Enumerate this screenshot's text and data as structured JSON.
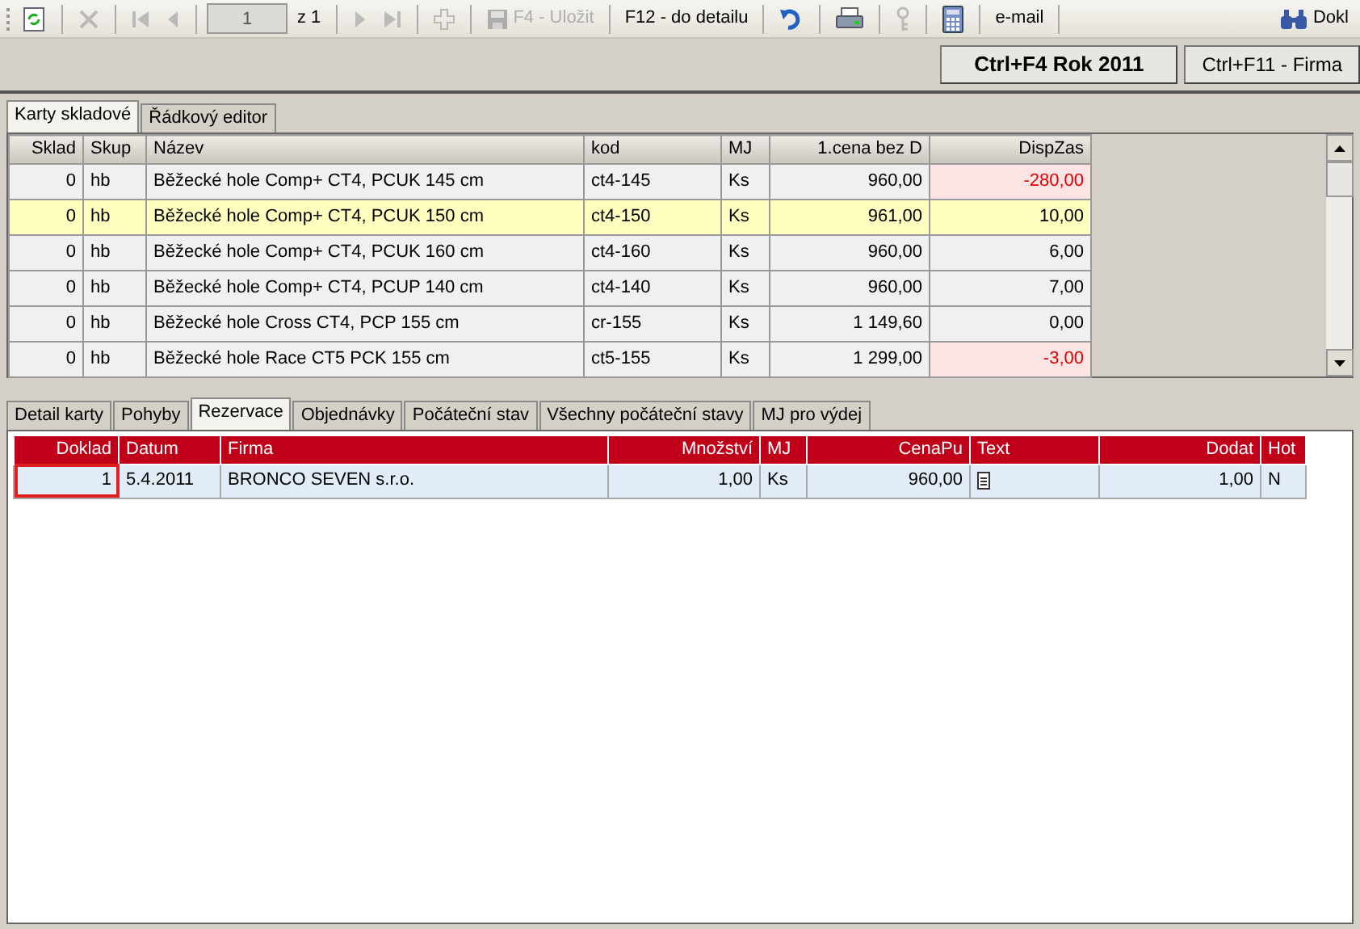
{
  "toolbar": [
    {
      "kind": "refresh",
      "disabled": false
    },
    {
      "kind": "sep"
    },
    {
      "kind": "delete",
      "disabled": true
    },
    {
      "kind": "sep"
    },
    {
      "kind": "first",
      "disabled": true
    },
    {
      "kind": "prev",
      "disabled": true
    },
    {
      "kind": "sep"
    },
    {
      "kind": "page",
      "value": "1",
      "label": "z 1"
    },
    {
      "kind": "sep"
    },
    {
      "kind": "next",
      "disabled": true
    },
    {
      "kind": "last",
      "disabled": true
    },
    {
      "kind": "sep"
    },
    {
      "kind": "add",
      "disabled": true
    },
    {
      "kind": "sep"
    },
    {
      "kind": "save",
      "label": "F4 - Uložit",
      "disabled": true
    },
    {
      "kind": "sep"
    },
    {
      "kind": "text",
      "label": "F12 - do detailu",
      "disabled": false
    },
    {
      "kind": "sep"
    },
    {
      "kind": "undo",
      "disabled": false
    },
    {
      "kind": "sep"
    },
    {
      "kind": "print",
      "disabled": false
    },
    {
      "kind": "sep"
    },
    {
      "kind": "key",
      "disabled": true
    },
    {
      "kind": "sep"
    },
    {
      "kind": "calc",
      "disabled": false
    },
    {
      "kind": "sep"
    },
    {
      "kind": "text",
      "label": "e-mail",
      "disabled": false
    },
    {
      "kind": "sep"
    },
    {
      "kind": "spacer"
    },
    {
      "kind": "find",
      "label": "Dokl",
      "disabled": false
    }
  ],
  "actions": [
    {
      "label": "Ctrl+F4 Rok 2011",
      "bold": true
    },
    {
      "label": "Ctrl+F11 - Firma",
      "bold": false
    }
  ],
  "upper_tabs": [
    {
      "label": "Karty skladové",
      "selected": true
    },
    {
      "label": "Řádkový editor",
      "selected": false
    }
  ],
  "stock_table": {
    "columns": [
      "Sklad",
      "Skup",
      "Název",
      "kod",
      "MJ",
      "1.cena bez D",
      "DispZas"
    ],
    "rows": [
      {
        "selected": false,
        "alert": true,
        "cells": [
          "0",
          "hb",
          "Běžecké hole Comp+ CT4, PCUK 145 cm",
          "ct4-145",
          "Ks",
          "960,00",
          "-280,00"
        ]
      },
      {
        "selected": true,
        "alert": false,
        "cells": [
          "0",
          "hb",
          "Běžecké hole Comp+ CT4, PCUK 150 cm",
          "ct4-150",
          "Ks",
          "961,00",
          "10,00"
        ]
      },
      {
        "selected": false,
        "alert": false,
        "cells": [
          "0",
          "hb",
          "Běžecké hole Comp+ CT4, PCUK 160 cm",
          "ct4-160",
          "Ks",
          "960,00",
          "6,00"
        ]
      },
      {
        "selected": false,
        "alert": false,
        "cells": [
          "0",
          "hb",
          "Běžecké hole Comp+ CT4, PCUP 140 cm",
          "ct4-140",
          "Ks",
          "960,00",
          "7,00"
        ]
      },
      {
        "selected": false,
        "alert": false,
        "cells": [
          "0",
          "hb",
          "Běžecké hole Cross CT4, PCP 155 cm",
          "cr-155",
          "Ks",
          "1 149,60",
          "0,00"
        ]
      },
      {
        "selected": false,
        "alert": true,
        "cells": [
          "0",
          "hb",
          "Běžecké hole Race CT5 PCK 155 cm",
          "ct5-155",
          "Ks",
          "1 299,00",
          "-3,00"
        ]
      }
    ]
  },
  "lower_tabs": [
    {
      "label": "Detail karty",
      "selected": false
    },
    {
      "label": "Pohyby",
      "selected": false
    },
    {
      "label": "Rezervace",
      "selected": true
    },
    {
      "label": "Objednávky",
      "selected": false
    },
    {
      "label": "Počáteční stav",
      "selected": false
    },
    {
      "label": "Všechny počáteční stavy",
      "selected": false
    },
    {
      "label": "MJ pro výdej",
      "selected": false
    }
  ],
  "reservations": {
    "columns": [
      "Doklad",
      "Datum",
      "Firma",
      "Množství",
      "MJ",
      "CenaPu",
      "Text",
      "Dodat",
      "Hot"
    ],
    "rows": [
      {
        "selected": true,
        "cells": [
          {
            "text": "1",
            "focused": true
          },
          {
            "text": "5.4.2011",
            "focused": false
          },
          {
            "text": "BRONCO SEVEN s.r.o.",
            "focused": false
          },
          {
            "text": "1,00",
            "focused": false
          },
          {
            "text": "Ks",
            "focused": false
          },
          {
            "text": "960,00",
            "focused": false
          },
          {
            "kind": "note",
            "focused": false
          },
          {
            "text": "1,00",
            "focused": false
          },
          {
            "text": "N",
            "focused": false
          }
        ]
      }
    ]
  }
}
